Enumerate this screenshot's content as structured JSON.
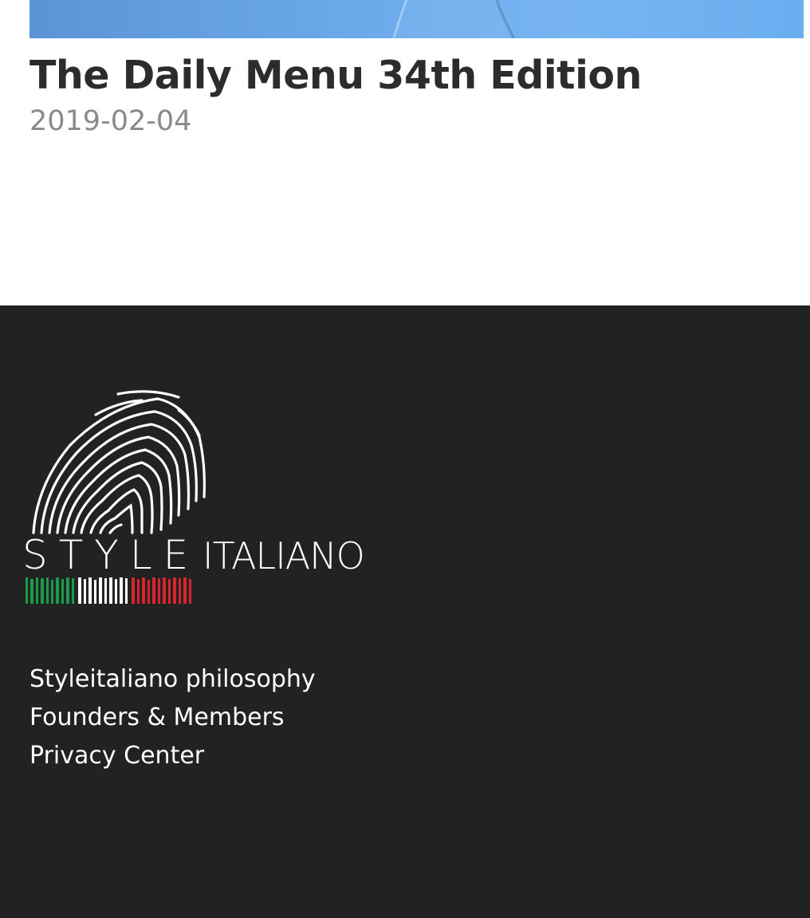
{
  "article": {
    "title": "The Daily Menu 34th Edition",
    "date": "2019-02-04",
    "hero_color": "#6aa8ea"
  },
  "footer": {
    "background": "#222222",
    "logo": {
      "word_style": "STYLE",
      "word_italiano": "ITALIANO",
      "icon": "fingerprint-icon",
      "flag_colors": [
        "#1a9a4a",
        "#ffffff",
        "#d8242c"
      ]
    },
    "links": [
      {
        "label": "Styleitaliano philosophy"
      },
      {
        "label": "Founders & Members"
      },
      {
        "label": "Privacy Center"
      }
    ]
  }
}
